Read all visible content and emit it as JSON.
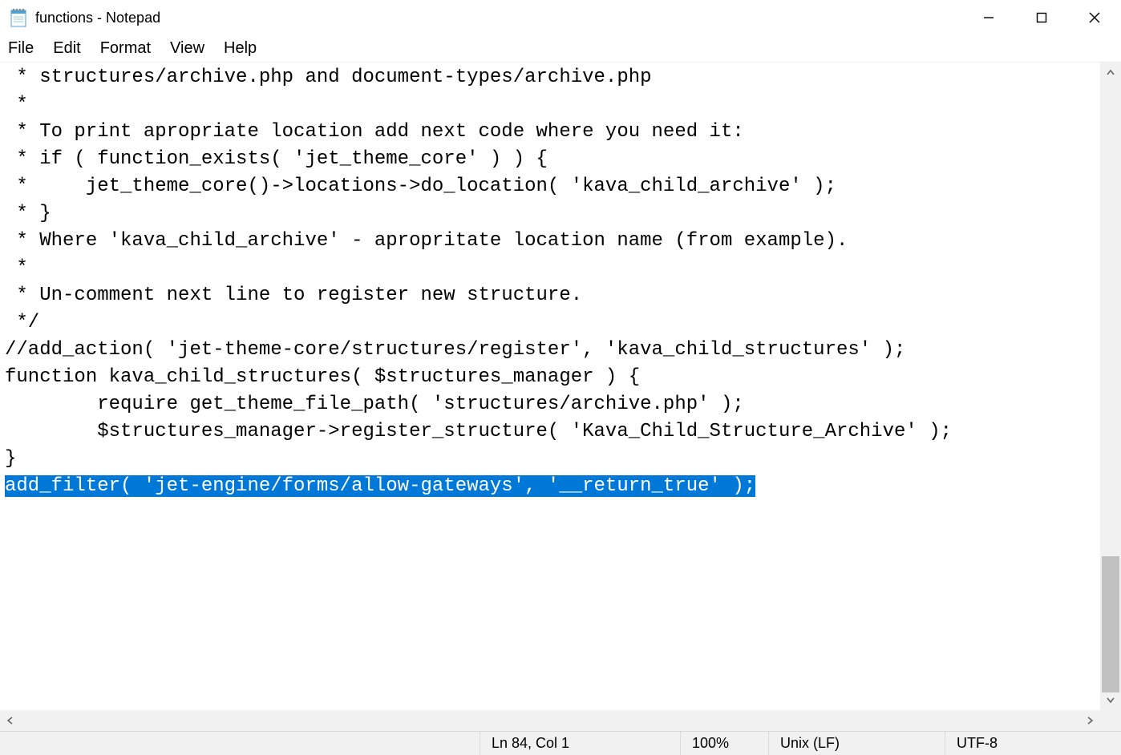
{
  "titlebar": {
    "title": "functions - Notepad"
  },
  "menu": {
    "file": "File",
    "edit": "Edit",
    "format": "Format",
    "view": "View",
    "help": "Help"
  },
  "editor": {
    "lines": [
      " * structures/archive.php and document-types/archive.php",
      " *",
      " * To print apropriate location add next code where you need it:",
      " * if ( function_exists( 'jet_theme_core' ) ) {",
      " *     jet_theme_core()->locations->do_location( 'kava_child_archive' );",
      " * }",
      " * Where 'kava_child_archive' - apropritate location name (from example).",
      " *",
      " * Un-comment next line to register new structure.",
      " */",
      "//add_action( 'jet-theme-core/structures/register', 'kava_child_structures' );",
      "",
      "function kava_child_structures( $structures_manager ) {",
      "",
      "        require get_theme_file_path( 'structures/archive.php' );",
      "",
      "        $structures_manager->register_structure( 'Kava_Child_Structure_Archive' );",
      "",
      "}"
    ],
    "selected_line": "add_filter( 'jet-engine/forms/allow-gateways', '__return_true' );"
  },
  "statusbar": {
    "position": "Ln 84, Col 1",
    "zoom": "100%",
    "line_ending": "Unix (LF)",
    "encoding": "UTF-8"
  }
}
